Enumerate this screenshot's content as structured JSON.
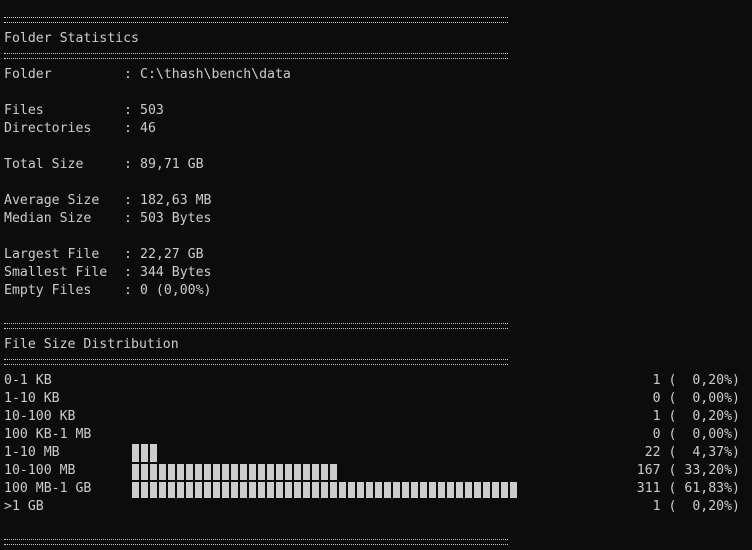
{
  "header": {
    "title": "Folder Statistics"
  },
  "stats": [
    {
      "label": "Folder",
      "value": "C:\\thash\\bench\\data"
    },
    {
      "label": "Files",
      "value": "503"
    },
    {
      "label": "Directories",
      "value": "46"
    },
    {
      "label": "Total Size",
      "value": "89,71 GB"
    },
    {
      "label": "Average Size",
      "value": "182,63 MB"
    },
    {
      "label": "Median Size",
      "value": "503 Bytes"
    },
    {
      "label": "Largest File",
      "value": "22,27 GB"
    },
    {
      "label": "Smallest File",
      "value": "344 Bytes"
    },
    {
      "label": "Empty Files",
      "value": "0 (0,00%)"
    }
  ],
  "colon": ":",
  "distribution": {
    "title": "File Size Distribution",
    "rows": [
      {
        "range": "0-1 KB",
        "count": "1",
        "percent": " 0,20%",
        "share": 0.2
      },
      {
        "range": "1-10 KB",
        "count": "0",
        "percent": " 0,00%",
        "share": 0.0
      },
      {
        "range": "10-100 KB",
        "count": "1",
        "percent": " 0,20%",
        "share": 0.2
      },
      {
        "range": "100 KB-1 MB",
        "count": "0",
        "percent": " 0,00%",
        "share": 0.0
      },
      {
        "range": "1-10 MB",
        "count": "22",
        "percent": " 4,37%",
        "share": 4.37
      },
      {
        "range": "10-100 MB",
        "count": "167",
        "percent": "33,20%",
        "share": 33.2
      },
      {
        "range": "100 MB-1 GB",
        "count": "311",
        "percent": "61,83%",
        "share": 61.83
      },
      {
        "range": ">1 GB",
        "count": "1",
        "percent": " 0,20%",
        "share": 0.2
      }
    ]
  }
}
